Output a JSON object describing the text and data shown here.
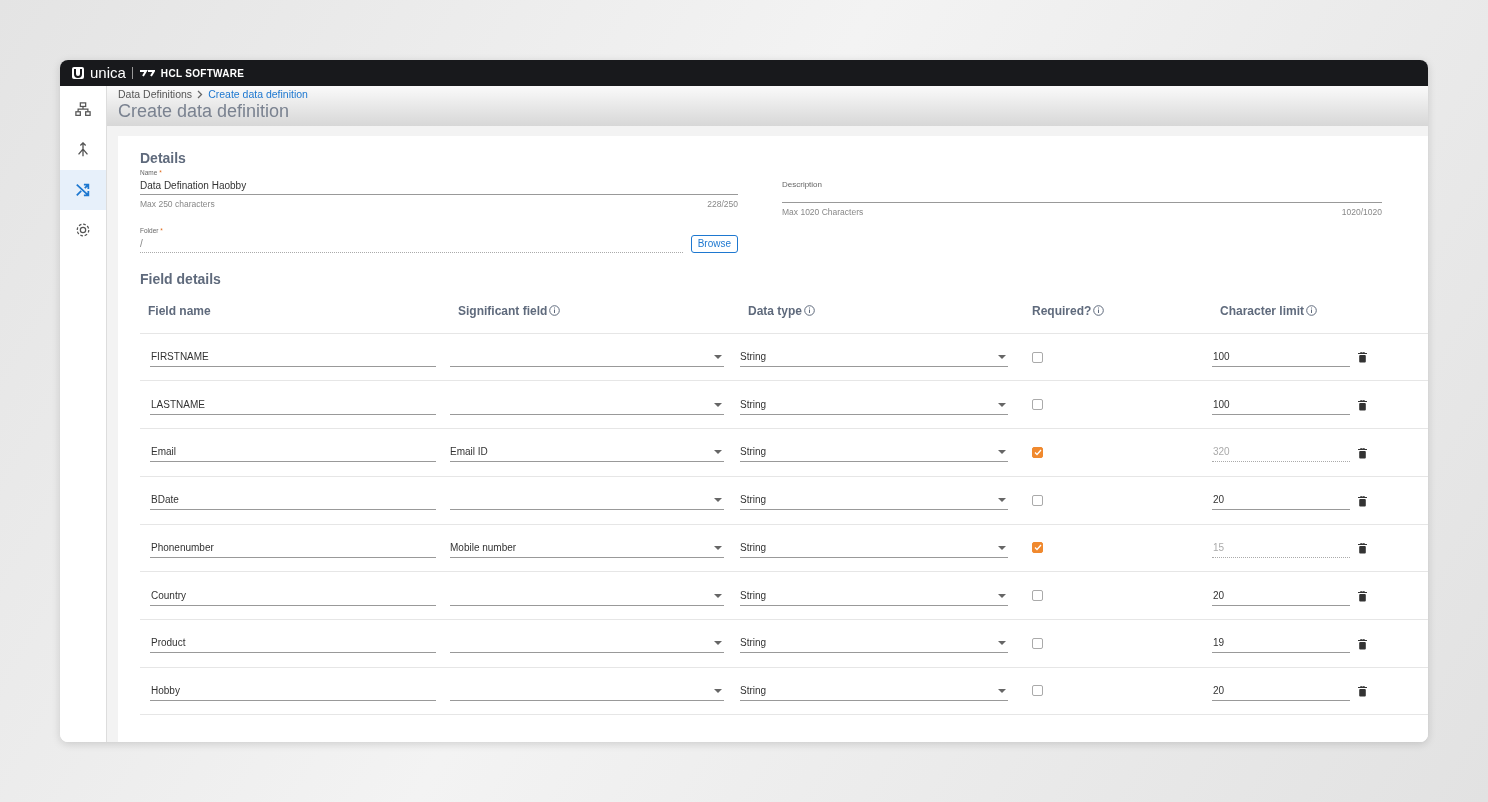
{
  "brand": {
    "product": "unica",
    "company": "HCL SOFTWARE"
  },
  "sidebar": {
    "items": [
      {
        "selected": false
      },
      {
        "selected": false
      },
      {
        "selected": true
      },
      {
        "selected": false
      }
    ]
  },
  "breadcrumb": [
    {
      "label": "Data Definitions",
      "selected": false
    },
    {
      "label": "Create data definition",
      "selected": true
    }
  ],
  "page_title": "Create data definition",
  "details": {
    "title": "Details",
    "name": {
      "label": "Name",
      "required_mark": "*",
      "value": "Data Defination Haobby",
      "hint": "Max 250 characters",
      "counter": "228/250"
    },
    "description": {
      "label": "Description",
      "hint": "Max 1020 Characters",
      "counter": "1020/1020"
    },
    "folder": {
      "label": "Folder",
      "required_mark": "*",
      "value": "/",
      "button": "Browse"
    }
  },
  "field_details": {
    "title": "Field details",
    "columns": [
      {
        "label": "Field name",
        "info": false
      },
      {
        "label": "Significant field",
        "info": true
      },
      {
        "label": "Data type",
        "info": true
      },
      {
        "label": "Required?",
        "info": true
      },
      {
        "label": "Character limit",
        "info": true
      }
    ],
    "rows": [
      {
        "name": "FIRSTNAME",
        "significant": "",
        "type": "String",
        "required": false,
        "limit": "100",
        "limit_disabled": false
      },
      {
        "name": "LASTNAME",
        "significant": "",
        "type": "String",
        "required": false,
        "limit": "100",
        "limit_disabled": false
      },
      {
        "name": "Email",
        "significant": "Email ID",
        "type": "String",
        "required": true,
        "limit": "320",
        "limit_disabled": true
      },
      {
        "name": "BDate",
        "significant": "",
        "type": "String",
        "required": false,
        "limit": "20",
        "limit_disabled": false
      },
      {
        "name": "Phonenumber",
        "significant": "Mobile number",
        "type": "String",
        "required": true,
        "limit": "15",
        "limit_disabled": true
      },
      {
        "name": "Country",
        "significant": "",
        "type": "String",
        "required": false,
        "limit": "20",
        "limit_disabled": false
      },
      {
        "name": "Product",
        "significant": "",
        "type": "String",
        "required": false,
        "limit": "19",
        "limit_disabled": false
      },
      {
        "name": "Hobby",
        "significant": "",
        "type": "String",
        "required": false,
        "limit": "20",
        "limit_disabled": false
      }
    ]
  }
}
